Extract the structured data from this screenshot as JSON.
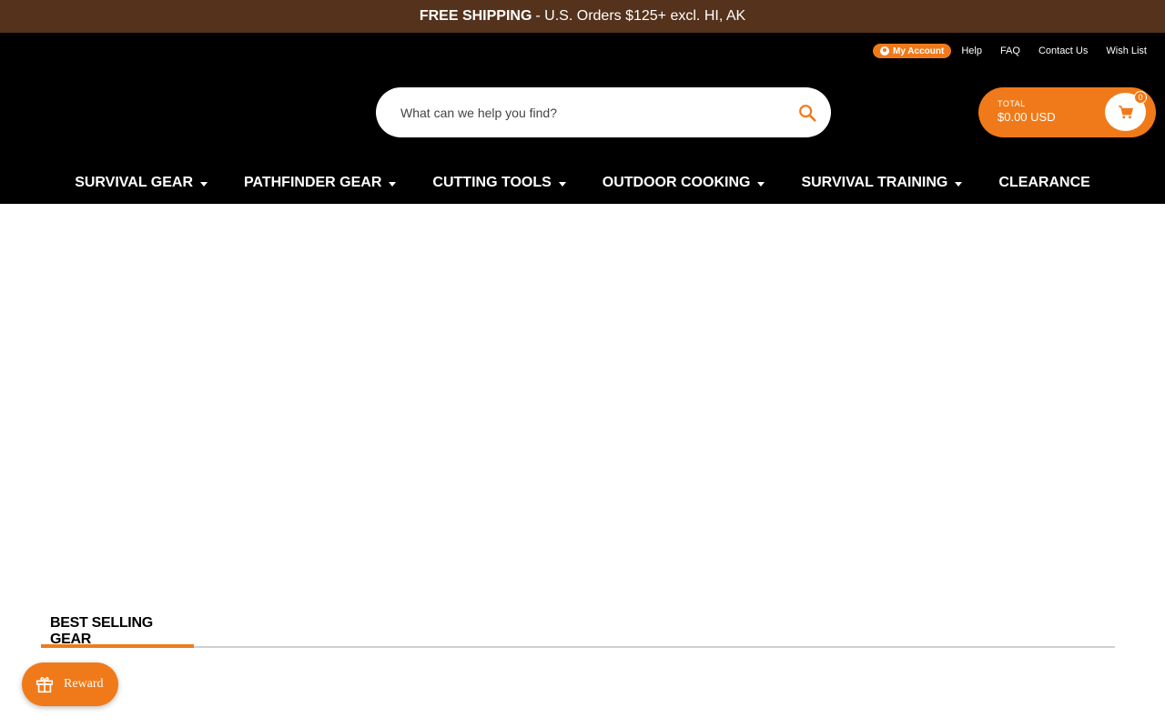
{
  "promo": {
    "strong": "FREE SHIPPING",
    "rest": "- U.S. Orders $125+ excl. HI, AK"
  },
  "utility_nav": {
    "account": "My Account",
    "links": [
      "Help",
      "FAQ",
      "Contact Us",
      "Wish List"
    ]
  },
  "search": {
    "placeholder": "What can we help you find?"
  },
  "cart": {
    "total_label": "TOTAL",
    "total_value": "$0.00 USD",
    "count": "0"
  },
  "main_nav": [
    {
      "label": "SURVIVAL GEAR",
      "dropdown": true
    },
    {
      "label": "PATHFINDER GEAR",
      "dropdown": true
    },
    {
      "label": "CUTTING TOOLS",
      "dropdown": true
    },
    {
      "label": "OUTDOOR COOKING",
      "dropdown": true
    },
    {
      "label": "SURVIVAL TRAINING",
      "dropdown": true
    },
    {
      "label": "CLEARANCE",
      "dropdown": false
    }
  ],
  "section": {
    "title": "BEST SELLING GEAR"
  },
  "reward": {
    "label": "Reward"
  },
  "colors": {
    "promo_bg": "#55321c",
    "header_bg": "#000000",
    "accent": "#f07a1a"
  }
}
